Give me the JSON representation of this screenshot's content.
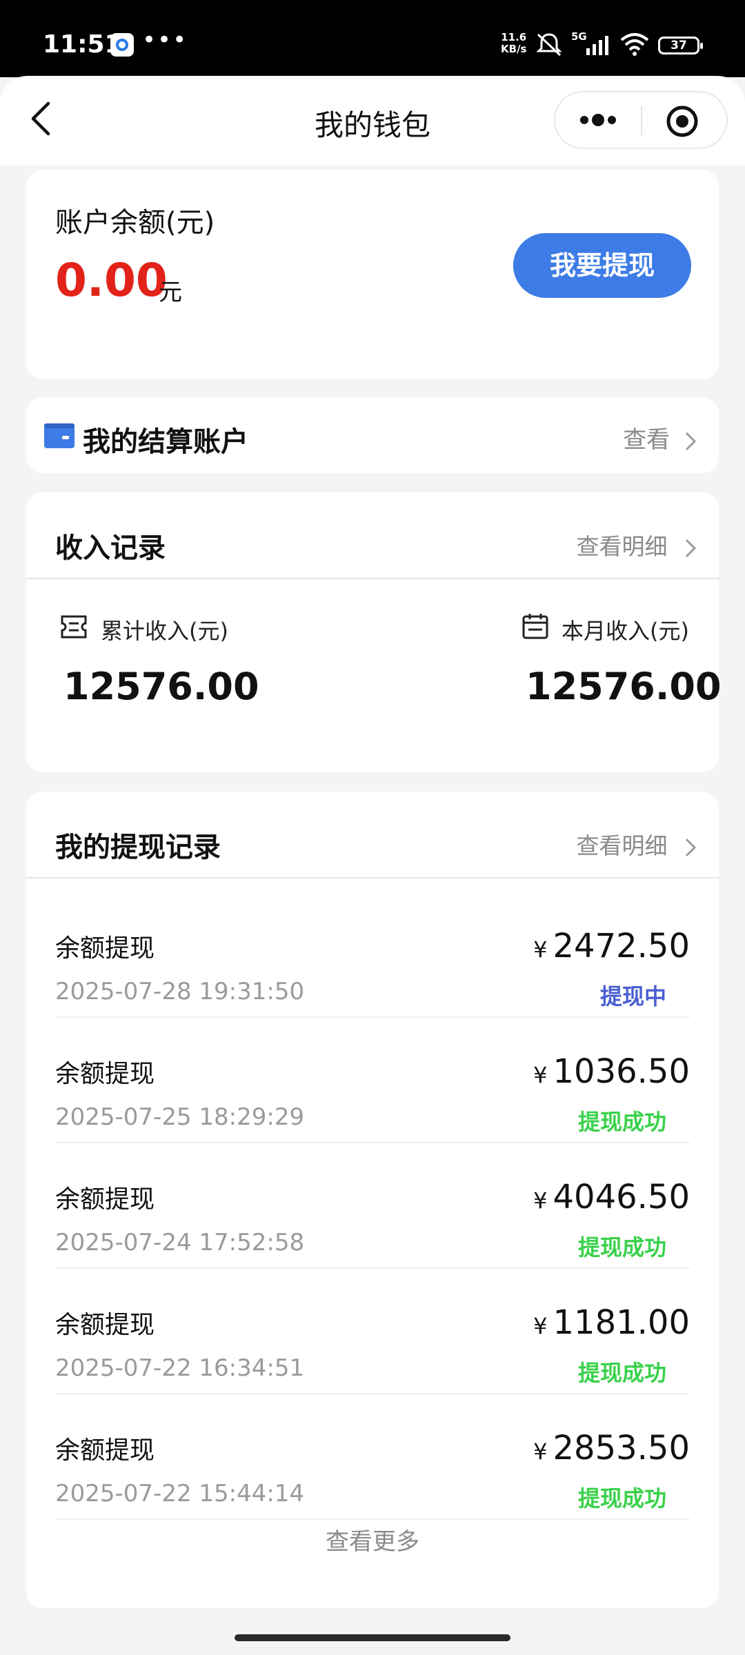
{
  "status_bar": {
    "time": "11:51",
    "dots": "•••",
    "net_speed_value": "11.6",
    "net_speed_unit": "KB/s",
    "network": "5G",
    "battery": "37"
  },
  "header": {
    "title": "我的钱包",
    "icons": [
      "back-arrow",
      "more-dots",
      "target-circle"
    ]
  },
  "balance": {
    "label": "账户余额(元)",
    "value": "0.00",
    "unit": "元",
    "withdraw_button": "我要提现"
  },
  "settlement": {
    "label": "我的结算账户",
    "view": "查看"
  },
  "income": {
    "title": "收入记录",
    "detail": "查看明细",
    "total_label": "累计收入(元)",
    "total_value": "12576.00",
    "month_label": "本月收入(元)",
    "month_value": "12576.00"
  },
  "withdrawals": {
    "title": "我的提现记录",
    "detail": "查看明细",
    "currency": "¥",
    "records": [
      {
        "title": "余额提现",
        "date": "2025-07-28 19:31:50",
        "amount": "2472.50",
        "status": "提现中",
        "status_color": "#4b5fd1"
      },
      {
        "title": "余额提现",
        "date": "2025-07-25 18:29:29",
        "amount": "1036.50",
        "status": "提现成功",
        "status_color": "#39d14a"
      },
      {
        "title": "余额提现",
        "date": "2025-07-24 17:52:58",
        "amount": "4046.50",
        "status": "提现成功",
        "status_color": "#39d14a"
      },
      {
        "title": "余额提现",
        "date": "2025-07-22 16:34:51",
        "amount": "1181.00",
        "status": "提现成功",
        "status_color": "#39d14a"
      },
      {
        "title": "余额提现",
        "date": "2025-07-22 15:44:14",
        "amount": "2853.50",
        "status": "提现成功",
        "status_color": "#39d14a"
      }
    ],
    "more": "查看更多"
  },
  "colors": {
    "accent_blue": "#3d7ce6",
    "balance_red": "#e2231a"
  }
}
